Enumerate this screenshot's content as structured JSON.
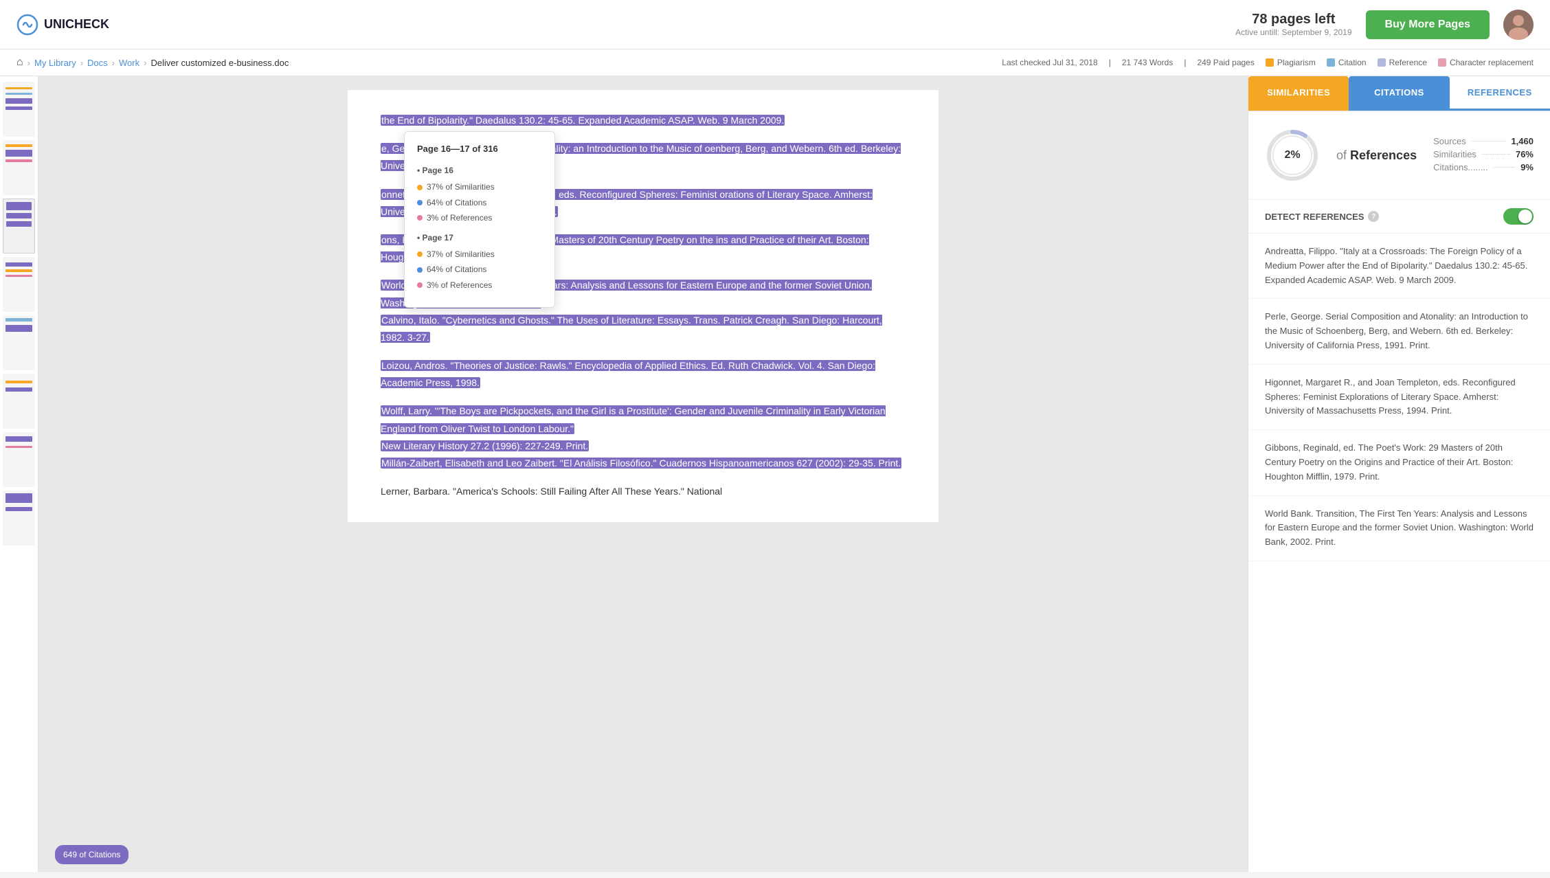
{
  "header": {
    "logo_text": "UNICHECK",
    "pages_left": "78 pages left",
    "pages_active": "Active untill: September 9, 2019",
    "buy_btn_label": "Buy More Pages"
  },
  "breadcrumb": {
    "home_icon": "🏠",
    "my_library": "My Library",
    "docs": "Docs",
    "work": "Work",
    "current": "Deliver customized e-business.doc"
  },
  "meta": {
    "last_checked": "Last checked Jul 31, 2018",
    "words": "21 743 Words",
    "paid_pages": "249 Paid pages",
    "legend": {
      "plagiarism": "Plagiarism",
      "citation": "Citation",
      "reference": "Reference",
      "character_replacement": "Character replacement"
    }
  },
  "panel": {
    "tab_similarities": "SIMILARITIES",
    "tab_citations": "CITATIONS",
    "tab_references": "REFERENCES",
    "circle_percent": "2%",
    "of_label": "of",
    "references_label": "References",
    "sources_label": "Sources",
    "sources_value": "1,460",
    "similarities_label": "Similarities",
    "similarities_value": "76%",
    "citations_label": "Citations........",
    "citations_value": "9%",
    "detect_references_label": "DETECT REFERENCES",
    "references_list": [
      "Andreatta, Filippo. \"Italy at a Crossroads: The Foreign Policy of a Medium Power after the End of Bipolarity.\" Daedalus 130.2: 45-65. Expanded Academic ASAP. Web. 9 March 2009.",
      "Perle, George. Serial Composition and Atonality: an Introduction to the Music of Schoenberg, Berg, and Webern. 6th ed. Berkeley: University of California Press, 1991. Print.",
      "Higonnet, Margaret R., and Joan Templeton, eds. Reconfigured Spheres: Feminist Explorations of Literary Space. Amherst: University of Massachusetts Press, 1994. Print.",
      "Gibbons, Reginald, ed. The Poet's Work: 29 Masters of 20th Century Poetry on the Origins and Practice of their Art. Boston: Houghton Mifflin, 1979. Print.",
      "World Bank. Transition, The First Ten Years: Analysis and Lessons for Eastern Europe and the former Soviet Union. Washington: World Bank, 2002. Print."
    ]
  },
  "tooltip": {
    "title": "Page 16—17 of 316",
    "page16_title": "• Page 16",
    "p16_similarities": "37% of Similarities",
    "p16_citations": "64% of Citations",
    "p16_references": "3% of References",
    "page17_title": "• Page 17",
    "p17_similarities": "37% of Similarities",
    "p17_citations": "64% of Citations",
    "p17_references": "3% of References"
  },
  "doc": {
    "para1": "the End of Bipolarity.\" Daedalus 130.2: 45-65. Expanded Academic ASAP. Web. 9 March 2009.",
    "para2": "e, George. Serial Composition and Atonality: an Introduction to the Music of oenberg, Berg, and Webern. 6th ed. Berkeley: University of California Press, 1991.",
    "para3": "onnet, Margaret R., and Joan Templeton, eds. Reconfigured Spheres: Feminist orations of Literary Space. Amherst: University of Massachusetts Press, 1994.",
    "para4": "ons, Reginald, ed. The Poet's Work: 29 Masters of 20th Century Poetry on the ins and Practice of their Art. Boston: Houghton Mifflin, 1979.",
    "para5_1": "World Bank. Transition, The First Ten Years: Analysis and Lessons for Eastern Europe and the former Soviet Union. Washington: World Bank, 2002. Print.",
    "para5_2": "Calvino, Italo. \"Cybernetics and Ghosts.\" The Uses of Literature: Essays. Trans. Patrick Creagh. San Diego: Harcourt, 1982. 3-27.",
    "para6": "Loizou, Andros. \"Theories of Justice: Rawls.\" Encyclopedia of Applied Ethics. Ed. Ruth Chadwick. Vol. 4. San Diego: Academic Press, 1998.",
    "para7_1": "Wolff, Larry. \"'The Boys are Pickpockets, and the Girl is a Prostitute': Gender and Juvenile Criminality in Early Victorian England from Oliver Twist to London Labour.\"",
    "para7_2": "New Literary History 27.2 (1996): 227-249. Print.",
    "para7_3": "Millán-Zaibert, Elisabeth and Leo Zaibert. \"El Análisis Filosófico.\" Cuadernos Hispanoamericanos 627 (2002): 29-35. Print.",
    "para8": "Lerner, Barbara. \"America's Schools: Still Failing After All These Years.\" National",
    "bottom_badge": "649 of Citations"
  }
}
